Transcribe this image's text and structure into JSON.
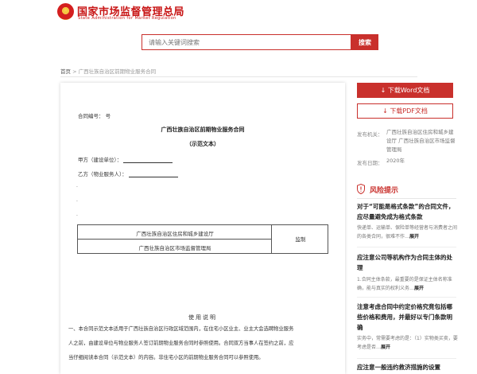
{
  "header": {
    "title": "国家市场监督管理总局",
    "subtitle": "State Administration for Market Regulation"
  },
  "search": {
    "placeholder": "请输入关键词搜索",
    "button_label": "搜索"
  },
  "breadcrumb": {
    "home": "首页",
    "separator": ">",
    "current": "广西壮族自治区前期物业服务合同"
  },
  "document": {
    "contract_no": "合同编号：    号",
    "title": "广西壮族自治区前期物业服务合同",
    "subtitle": "（示范文本）",
    "party_a": "甲方（建设单位）：",
    "party_b": "乙方（物业服务人）：",
    "dots": [
      "·",
      "·",
      "·"
    ],
    "table_row1": "广西壮族自治区住房和城乡建设厅",
    "table_row2": "广西壮族自治区市场监督管理局",
    "table_supervise": "监制",
    "usage_title": "使用说明",
    "usage_para1": "一、本合同示范文本适用于广西壮族自治区行政区域范围内，在住宅小区业主、业主大会选聘物业服务",
    "usage_para2": "人之前，由建设单位与物业服务人签订前期物业服务合同时参照使用。合同双方当事人在签约之前，应",
    "usage_para3": "当仔细阅读本合同（示范文本）的内容。非住宅小区的前期物业服务合同可以参照使用。"
  },
  "sidebar": {
    "download_word": "下载Word文档",
    "download_pdf": "下载PDF文档",
    "publisher_label": "发布机关：",
    "publisher_value": "广西壮族自治区住房和城乡建设厅 广西壮族自治区市场监督管理局",
    "date_label": "发布日期：",
    "date_value": "2020年",
    "risk_title": "风险提示",
    "risk_items": [
      {
        "title": "对于“可能是格式条款”的合同文件，应尽量避免成为格式条款",
        "desc": "快递单、运输单、保险单等经营者与消费者之间的各类合同，很难不作…",
        "expand": "展开"
      },
      {
        "title": "应注意公司等机构作为合同主体的处理",
        "desc": "1.合同主体条款，最重要的是保证主体名称准确，能与真实的权利义务…",
        "expand": "展开"
      },
      {
        "title": "注意考虑合同中约定价格究竟包括哪些价格和费用，并最好以专门条款明确",
        "desc": "实务中，常需要考虑的是：（1）实物类买卖，要考虑是否…",
        "expand": "展开"
      },
      {
        "title": "应注意一般违约救济措施的设置",
        "desc": "",
        "expand": ""
      }
    ]
  },
  "colors": {
    "brand_red": "#c9302c",
    "title_red": "#c81414"
  }
}
